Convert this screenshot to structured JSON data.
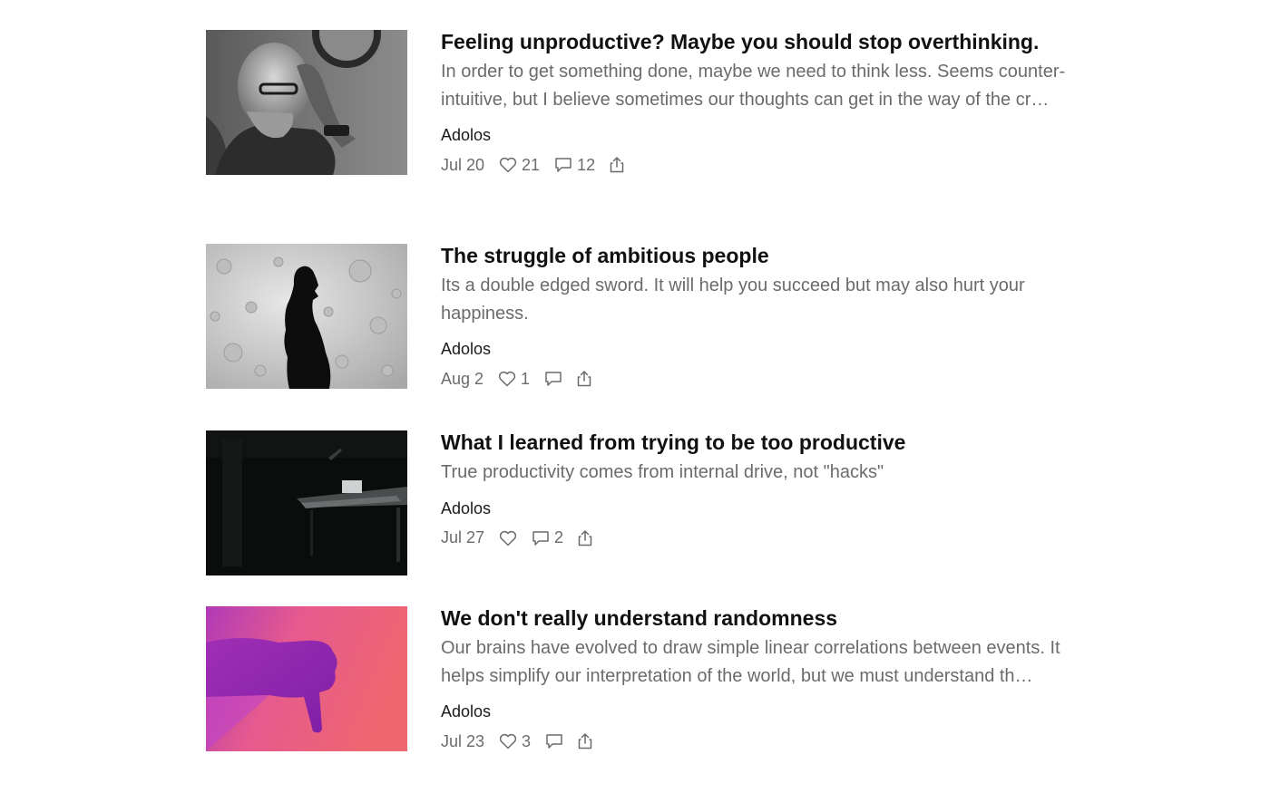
{
  "posts": [
    {
      "title": "Feeling unproductive? Maybe you should stop overthinking.",
      "excerpt": "In order to get something done, maybe we need to think less. Seems counter-intuitive, but I believe sometimes our thoughts can get in the way of the cr…",
      "author": "Adolos",
      "date": "Jul 20",
      "likes": "21",
      "comments": "12",
      "image": "man-thinking-photo"
    },
    {
      "title": "The struggle of ambitious people",
      "excerpt": "Its a double edged sword. It will help you succeed but may also hurt your happiness.",
      "author": "Adolos",
      "date": "Aug 2",
      "likes": "1",
      "comments": "",
      "image": "woman-silhouette-moon-photo"
    },
    {
      "title": "What I learned from trying to be too productive",
      "excerpt": "True productivity comes from internal drive, not \"hacks\"",
      "author": "Adolos",
      "date": "Jul 27",
      "likes": "",
      "comments": "2",
      "image": "dark-desk-photo"
    },
    {
      "title": "We don't really understand randomness",
      "excerpt": "Our brains have evolved to draw simple linear correlations between events. It helps simplify our interpretation of the world, but we must understand th…",
      "author": "Adolos",
      "date": "Jul 23",
      "likes": "3",
      "comments": "",
      "image": "thumbs-down-photo"
    }
  ],
  "icons": {
    "like": "heart-icon",
    "comment": "comment-icon",
    "share": "share-icon"
  },
  "colors": {
    "title": "#111111",
    "excerpt": "#6b6b6b",
    "meta": "#6b6b6b"
  }
}
